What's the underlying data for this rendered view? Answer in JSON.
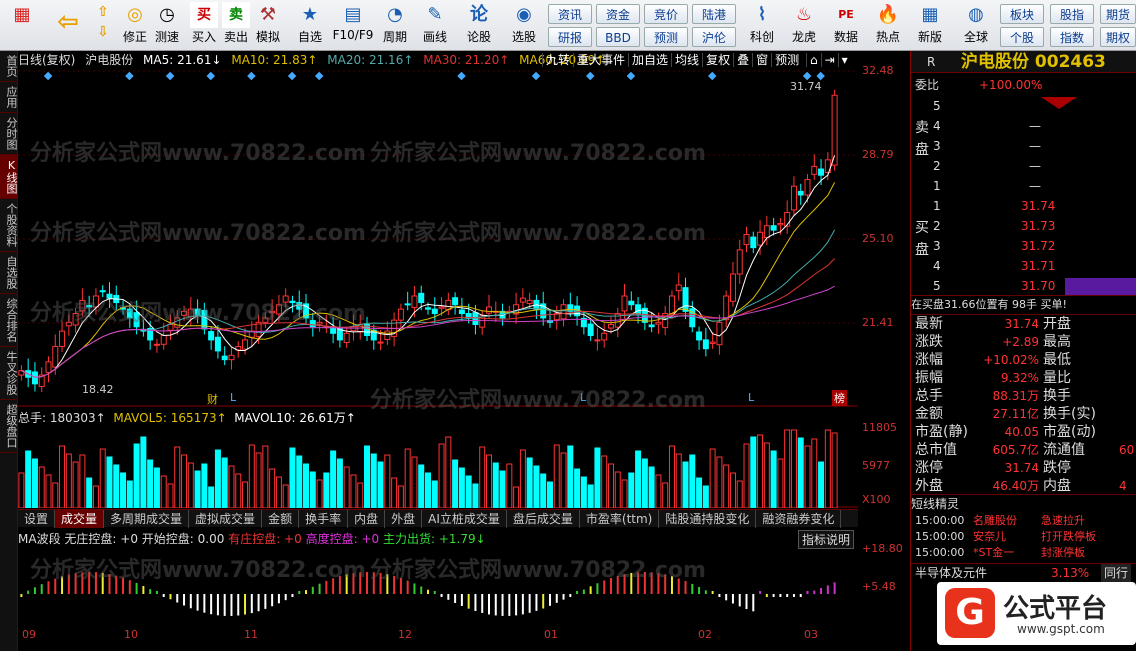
{
  "toolbar": {
    "buttons": [
      "买入",
      "卖出",
      "模拟",
      "自选",
      "F10/F9",
      "周期",
      "画线",
      "论股",
      "选股",
      "科创",
      "龙虎",
      "数据",
      "热点",
      "新版",
      "全球"
    ],
    "icon_buttons": [
      "修正",
      "测速"
    ],
    "small": [
      [
        "资讯",
        "研报"
      ],
      [
        "资金",
        "BBD"
      ],
      [
        "竞价",
        "预测"
      ],
      [
        "陆港",
        "沪伦"
      ]
    ],
    "right_small": [
      [
        "板块",
        "个股"
      ],
      [
        "股指",
        "指数"
      ],
      [
        "期货",
        "期权"
      ]
    ]
  },
  "left_tabs": [
    "首页",
    "应用",
    "分时图",
    "K线图",
    "个股资料",
    "自选股",
    "综合排名",
    "牛叉诊股",
    "超级盘口"
  ],
  "title": {
    "period": "日线(复权)",
    "name": "沪电股份",
    "ma5": "MA5: 21.61↓",
    "ma10": "MA10: 21.83↑",
    "ma20": "MA20: 21.16↑",
    "ma30": "MA30: 21.20↑",
    "ma60": "MA60: 20.99↑"
  },
  "top_menu": [
    "九转",
    "重大事件",
    "加自选",
    "均线",
    "复权",
    "叠",
    "窗",
    "预测"
  ],
  "price_axis": [
    "32.48",
    "28.79",
    "25.10",
    "21.41"
  ],
  "vol_axis": [
    "11805",
    "5977",
    "X100"
  ],
  "ind_axis": [
    "+18.80",
    "+5.48"
  ],
  "annot": {
    "high": "31.74",
    "low": "18.42",
    "cai": "财",
    "L": "L",
    "bang": "榜"
  },
  "vol_title": {
    "total": "总手: 180303↑",
    "mavol5": "MAVOL5: 165173↑",
    "mavol10": "MAVOL10: 26.61万↑"
  },
  "tabs": [
    "设置",
    "成交量",
    "多周期成交量",
    "虚拟成交量",
    "金额",
    "换手率",
    "内盘",
    "外盘",
    "AI立桩成交量",
    "盘后成交量",
    "市盈率(ttm)",
    "陆股通持股变化",
    "融资融券变化"
  ],
  "ind_title": {
    "name": "MA波段",
    "a": "无庄控盘: +0",
    "b": "开始控盘: 0.00",
    "c": "有庄控盘: +0",
    "d": "高度控盘: +0",
    "e": "主力出货: +1.79↓",
    "help": "指标说明"
  },
  "months": [
    "09",
    "10",
    "11",
    "12",
    "01",
    "02",
    "03"
  ],
  "watermark": "分析家公式网www.70822.com",
  "right": {
    "code_label": "R",
    "stock": "沪电股份 002463",
    "weibi_label": "委比",
    "weibi": "+100.00%",
    "sell_label": "卖盘",
    "buy_label": "买盘",
    "sell": [
      [
        "5",
        ""
      ],
      [
        "4",
        "—"
      ],
      [
        "3",
        "—"
      ],
      [
        "2",
        "—"
      ],
      [
        "1",
        "—"
      ]
    ],
    "buy": [
      [
        "1",
        "31.74"
      ],
      [
        "2",
        "31.73"
      ],
      [
        "3",
        "31.72"
      ],
      [
        "4",
        "31.71"
      ],
      [
        "5",
        "31.70"
      ]
    ],
    "info_line": "在买盘31.66位置有  98手  买单!",
    "stats": [
      [
        "最新",
        "31.74",
        "开盘",
        ""
      ],
      [
        "涨跌",
        "+2.89",
        "最高",
        ""
      ],
      [
        "涨幅",
        "+10.02%",
        "最低",
        ""
      ],
      [
        "振幅",
        "9.32%",
        "量比",
        ""
      ],
      [
        "总手",
        "88.31万",
        "换手",
        ""
      ],
      [
        "金额",
        "27.11亿",
        "换手(实)",
        ""
      ],
      [
        "市盈(静)",
        "40.05",
        "市盈(动)",
        ""
      ],
      [
        "总市值",
        "605.7亿",
        "流通值",
        "60"
      ],
      [
        "涨停",
        "31.74",
        "跌停",
        ""
      ],
      [
        "外盘",
        "46.40万",
        "内盘",
        "4"
      ]
    ],
    "sprite_title": "短线精灵",
    "sprites": [
      [
        "15:00:00",
        "名雕股份",
        "急速拉升"
      ],
      [
        "15:00:00",
        "安奈儿",
        "打开跌停板"
      ],
      [
        "15:00:00",
        "*ST金一",
        "封涨停板"
      ]
    ],
    "sector": "半导体及元件",
    "sector_pct": "3.13%",
    "sector_tab": "同行",
    "logo_text": "公式平台",
    "logo_url": "www.gspt.com"
  },
  "chart_data": {
    "type": "candlestick",
    "title": "沪电股份 日线(复权)",
    "ylim": [
      18.0,
      32.48
    ],
    "x": [
      "09",
      "10",
      "11",
      "12",
      "01",
      "02",
      "03"
    ],
    "notes": "approximate daily closes Sep→Mar",
    "close": [
      19.2,
      18.9,
      18.6,
      19.0,
      19.6,
      20.3,
      21.0,
      21.4,
      21.8,
      22.4,
      22.1,
      22.6,
      22.8,
      22.5,
      22.3,
      22.0,
      21.6,
      21.2,
      21.0,
      20.6,
      20.4,
      20.8,
      21.3,
      21.6,
      21.9,
      22.0,
      21.7,
      21.1,
      20.6,
      20.1,
      19.7,
      19.9,
      20.3,
      20.6,
      21.0,
      21.4,
      21.6,
      21.9,
      22.2,
      22.6,
      22.3,
      22.0,
      21.6,
      21.2,
      21.4,
      21.2,
      20.9,
      20.6,
      20.9,
      21.2,
      21.3,
      20.8,
      20.6,
      20.5,
      21.0,
      21.5,
      22.0,
      22.2,
      22.6,
      22.3,
      22.0,
      21.8,
      22.1,
      22.4,
      22.2,
      21.8,
      21.6,
      21.3,
      21.7,
      22.1,
      21.9,
      21.6,
      21.9,
      22.2,
      22.5,
      22.4,
      22.0,
      21.6,
      21.4,
      21.8,
      22.2,
      21.9,
      21.7,
      21.2,
      20.8,
      20.6,
      20.9,
      21.3,
      21.8,
      22.6,
      22.2,
      21.8,
      21.4,
      21.2,
      21.4,
      21.8,
      22.6,
      23.1,
      21.9,
      21.2,
      20.6,
      20.2,
      20.5,
      21.4,
      22.6,
      23.6,
      24.7,
      25.4,
      24.8,
      25.5,
      25.8,
      25.6,
      25.9,
      26.4,
      27.6,
      27.2,
      27.9,
      28.5,
      28.1,
      28.8,
      31.74
    ],
    "high": 31.74,
    "low": 18.42,
    "ma_labels": [
      "MA5",
      "MA10",
      "MA20",
      "MA30",
      "MA60"
    ]
  }
}
